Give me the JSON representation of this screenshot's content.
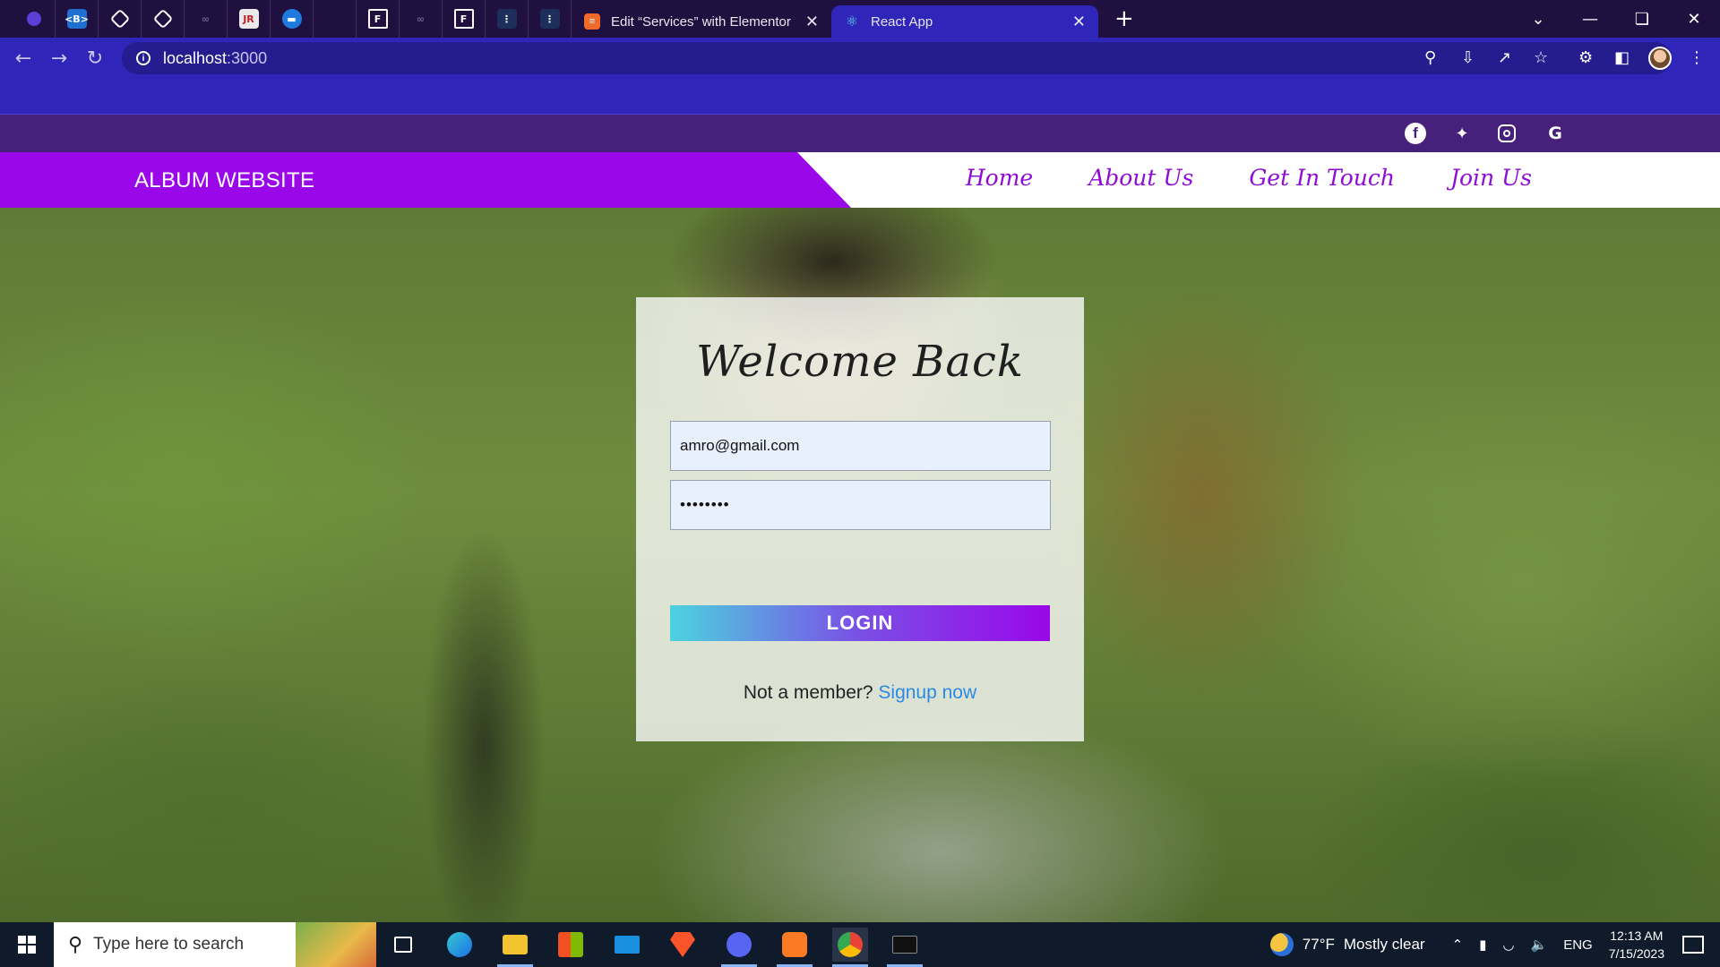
{
  "browser": {
    "tabs": [
      {
        "title": "Edit “Services” with Elementor",
        "favicon": "elementor-icon",
        "active": false
      },
      {
        "title": "React App",
        "favicon": "react-icon",
        "active": true
      }
    ],
    "pinned_icons": [
      "circle-app-icon",
      "bootstrap-icon",
      "codepen-icon",
      "codepen-icon",
      "link-icon",
      "jr-icon",
      "stripe-icon",
      "blank-icon",
      "frame-icon",
      "link-icon",
      "frame-icon",
      "dots-icon",
      "dots-icon"
    ],
    "pinned_labels": [
      "",
      "",
      "",
      "",
      "",
      "JR",
      "",
      "",
      "",
      "",
      "",
      "",
      ""
    ],
    "address": {
      "host": "localhost",
      "port": ":3000"
    },
    "accent": "#2f25b8",
    "tabbar_bg": "#20103f"
  },
  "site": {
    "brand": "ALBUM WEBSITE",
    "nav": [
      "Home",
      "About Us",
      "Get In Touch",
      "Join Us"
    ],
    "social_icons": [
      "facebook-icon",
      "twitter-icon",
      "instagram-icon",
      "google-icon"
    ],
    "brand_color": "#9a07e8",
    "nav_color": "#8f0bd6"
  },
  "login": {
    "title": "Welcome Back",
    "email_value": "amro@gmail.com",
    "password_value": "••••••••",
    "button_label": "LOGIN",
    "member_prompt": "Not a member?",
    "signup_link": "Signup now",
    "link_color": "#2a8ae3"
  },
  "taskbar": {
    "search_placeholder": "Type here to search",
    "apps": [
      "task-view-icon",
      "edge-icon",
      "file-explorer-icon",
      "store-icon",
      "mail-icon",
      "brave-icon",
      "discord-icon",
      "xampp-icon",
      "chrome-icon",
      "terminal-icon"
    ],
    "weather_temp": "77°F",
    "weather_desc": "Mostly clear",
    "language": "ENG",
    "time": "12:13 AM",
    "date": "7/15/2023"
  }
}
